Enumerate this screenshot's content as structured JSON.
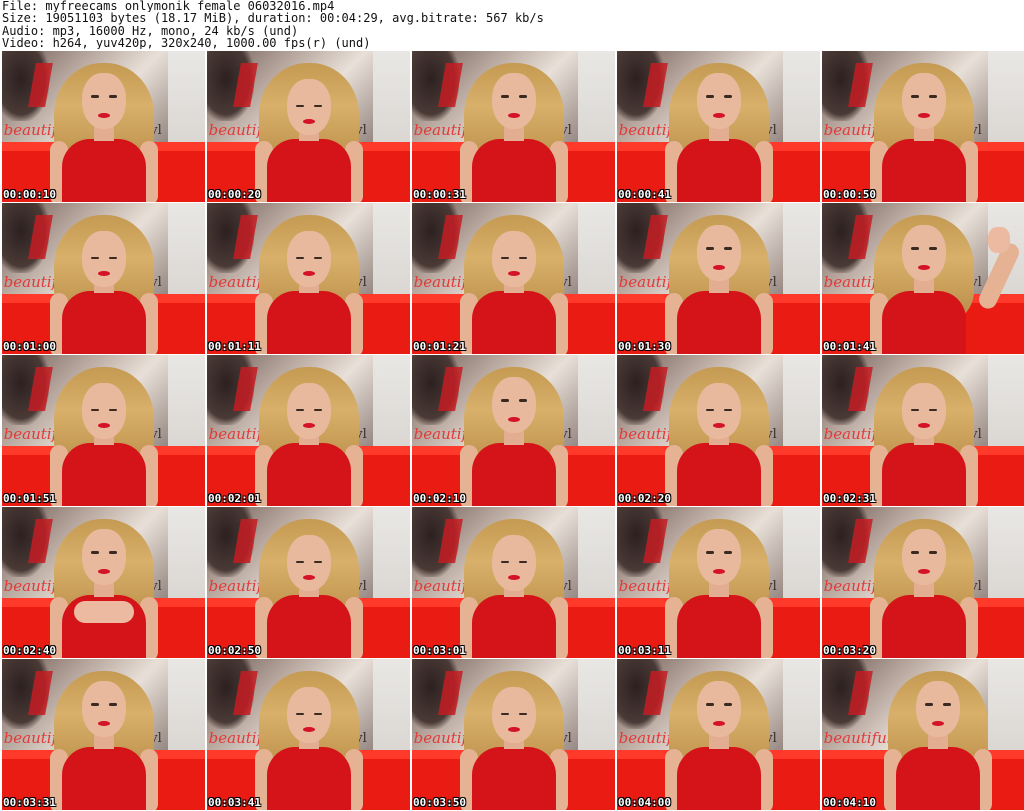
{
  "header": {
    "file_line": "File: myfreecams_onlymonik_female_06032016.mp4",
    "size_line": "Size: 19051103 bytes (18.17 MiB), duration: 00:04:29, avg.bitrate: 567 kb/s",
    "audio_line": "Audio: mp3, 16000 Hz, mono, 24 kb/s (und)",
    "video_line": "Video: h264, yuv420p, 320x240, 1000.00 fps(r) (und)"
  },
  "poster": {
    "word_left": "beautiful",
    "word_right": "styl"
  },
  "thumbnails": [
    {
      "time": "00:00:10",
      "pose": "front"
    },
    {
      "time": "00:00:20",
      "pose": "look-down"
    },
    {
      "time": "00:00:31",
      "pose": "front"
    },
    {
      "time": "00:00:41",
      "pose": "front"
    },
    {
      "time": "00:00:50",
      "pose": "front"
    },
    {
      "time": "00:01:00",
      "pose": "look-down"
    },
    {
      "time": "00:01:11",
      "pose": "look-down"
    },
    {
      "time": "00:01:21",
      "pose": "look-down"
    },
    {
      "time": "00:01:30",
      "pose": "front"
    },
    {
      "time": "00:01:41",
      "pose": "wave"
    },
    {
      "time": "00:01:51",
      "pose": "look-down"
    },
    {
      "time": "00:02:01",
      "pose": "look-down"
    },
    {
      "time": "00:02:10",
      "pose": "front"
    },
    {
      "time": "00:02:20",
      "pose": "look-down"
    },
    {
      "time": "00:02:31",
      "pose": "look-down"
    },
    {
      "time": "00:02:40",
      "pose": "hands"
    },
    {
      "time": "00:02:50",
      "pose": "look-down"
    },
    {
      "time": "00:03:01",
      "pose": "look-down"
    },
    {
      "time": "00:03:11",
      "pose": "front"
    },
    {
      "time": "00:03:20",
      "pose": "front"
    },
    {
      "time": "00:03:31",
      "pose": "front"
    },
    {
      "time": "00:03:41",
      "pose": "look-down"
    },
    {
      "time": "00:03:50",
      "pose": "look-down"
    },
    {
      "time": "00:04:00",
      "pose": "front"
    },
    {
      "time": "00:04:10",
      "pose": "lean"
    }
  ],
  "colors": {
    "background": "#ffffff",
    "sofa_red": "#ea1b12",
    "top_red": "#d5141a",
    "timestamp_text": "#ffffff"
  }
}
